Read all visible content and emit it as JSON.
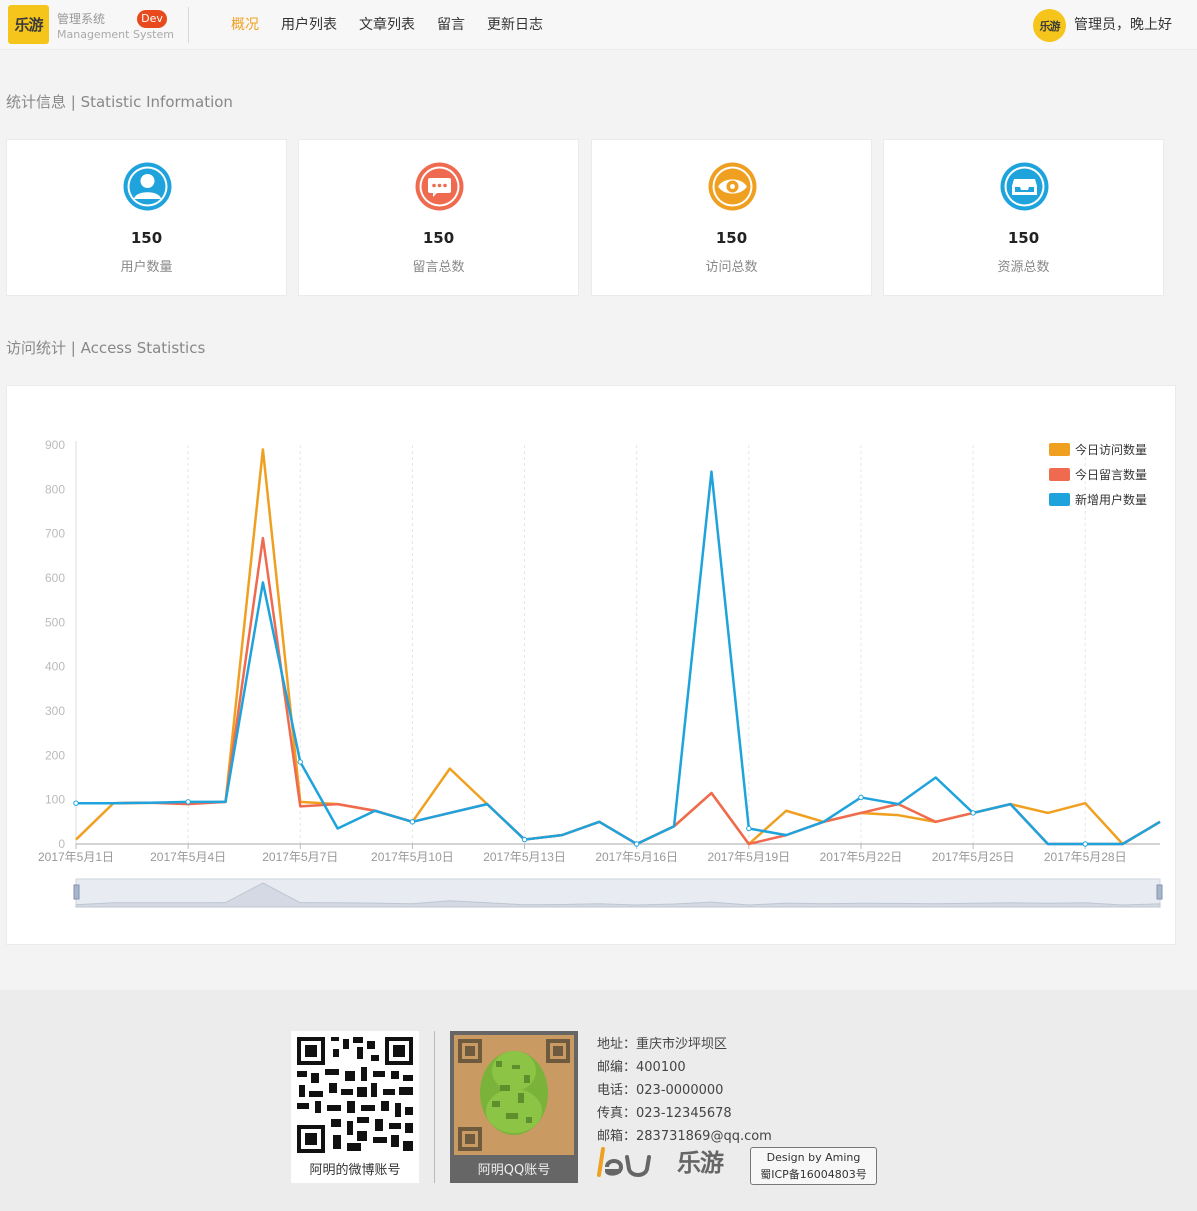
{
  "header": {
    "logo_text": "乐游",
    "system_name": "管理系统",
    "system_subtitle": "Management System",
    "env_badge": "Dev",
    "nav": [
      {
        "label": "概况",
        "active": true
      },
      {
        "label": "用户列表",
        "active": false
      },
      {
        "label": "文章列表",
        "active": false
      },
      {
        "label": "留言",
        "active": false
      },
      {
        "label": "更新日志",
        "active": false
      }
    ],
    "user_avatar_text": "乐游",
    "greeting": "管理员，晚上好"
  },
  "stats_section": {
    "title": "统计信息 | Statistic Information",
    "cards": [
      {
        "icon": "user-icon",
        "color": "#1fa3dc",
        "value": "150",
        "label": "用户数量"
      },
      {
        "icon": "message-icon",
        "color": "#ef6a4f",
        "value": "150",
        "label": "留言总数"
      },
      {
        "icon": "eye-icon",
        "color": "#f0a020",
        "value": "150",
        "label": "访问总数"
      },
      {
        "icon": "inbox-icon",
        "color": "#1fa3dc",
        "value": "150",
        "label": "资源总数"
      }
    ]
  },
  "access_section": {
    "title": "访问统计 | Access Statistics"
  },
  "chart_data": {
    "type": "line",
    "x": [
      "2017年5月1日",
      "2017年5月2日",
      "2017年5月3日",
      "2017年5月4日",
      "2017年5月5日",
      "2017年5月6日",
      "2017年5月7日",
      "2017年5月8日",
      "2017年5月9日",
      "2017年5月10日",
      "2017年5月11日",
      "2017年5月12日",
      "2017年5月13日",
      "2017年5月14日",
      "2017年5月15日",
      "2017年5月16日",
      "2017年5月17日",
      "2017年5月18日",
      "2017年5月19日",
      "2017年5月20日",
      "2017年5月21日",
      "2017年5月22日",
      "2017年5月23日",
      "2017年5月24日",
      "2017年5月25日",
      "2017年5月26日",
      "2017年5月27日",
      "2017年5月28日",
      "2017年5月29日",
      "2017年5月30日"
    ],
    "x_tick_labels": [
      "2017年5月1日",
      "2017年5月4日",
      "2017年5月7日",
      "2017年5月10日",
      "2017年5月13日",
      "2017年5月16日",
      "2017年5月19日",
      "2017年5月22日",
      "2017年5月25日",
      "2017年5月28日"
    ],
    "y_ticks": [
      "0",
      "100",
      "200",
      "300",
      "400",
      "500",
      "600",
      "700",
      "800",
      "900"
    ],
    "ylim": [
      0,
      900
    ],
    "legend_position": "top-right",
    "grid": "vertical-dashed",
    "series": [
      {
        "name": "今日访问数量",
        "color": "#f0a020",
        "values": [
          10,
          92,
          93,
          93,
          95,
          890,
          95,
          90,
          75,
          50,
          170,
          90,
          10,
          20,
          50,
          0,
          40,
          115,
          0,
          75,
          50,
          70,
          65,
          50,
          70,
          90,
          70,
          92,
          0,
          50
        ]
      },
      {
        "name": "今日留言数量",
        "color": "#ef6a4f",
        "values": [
          92,
          92,
          93,
          90,
          95,
          690,
          85,
          90,
          75,
          50,
          70,
          90,
          10,
          20,
          50,
          0,
          40,
          115,
          0,
          20,
          50,
          70,
          90,
          50,
          70,
          90,
          0,
          0,
          0,
          50
        ]
      },
      {
        "name": "新增用户数量",
        "color": "#1fa3dc",
        "values": [
          92,
          92,
          93,
          95,
          95,
          590,
          185,
          35,
          75,
          50,
          70,
          90,
          10,
          20,
          50,
          0,
          40,
          840,
          35,
          20,
          50,
          105,
          90,
          150,
          70,
          90,
          0,
          0,
          0,
          50
        ]
      }
    ]
  },
  "footer": {
    "weibo_label": "阿明的微博账号",
    "qq_label": "阿明QQ账号",
    "info": [
      "地址：重庆市沙坪坝区",
      "邮编：400100",
      "电话：023-0000000",
      "传真：023-12345678",
      "邮箱：283731869@qq.com"
    ],
    "brand_text": "乐游",
    "design_by": "Design by Aming",
    "icp": "蜀ICP备16004803号"
  }
}
